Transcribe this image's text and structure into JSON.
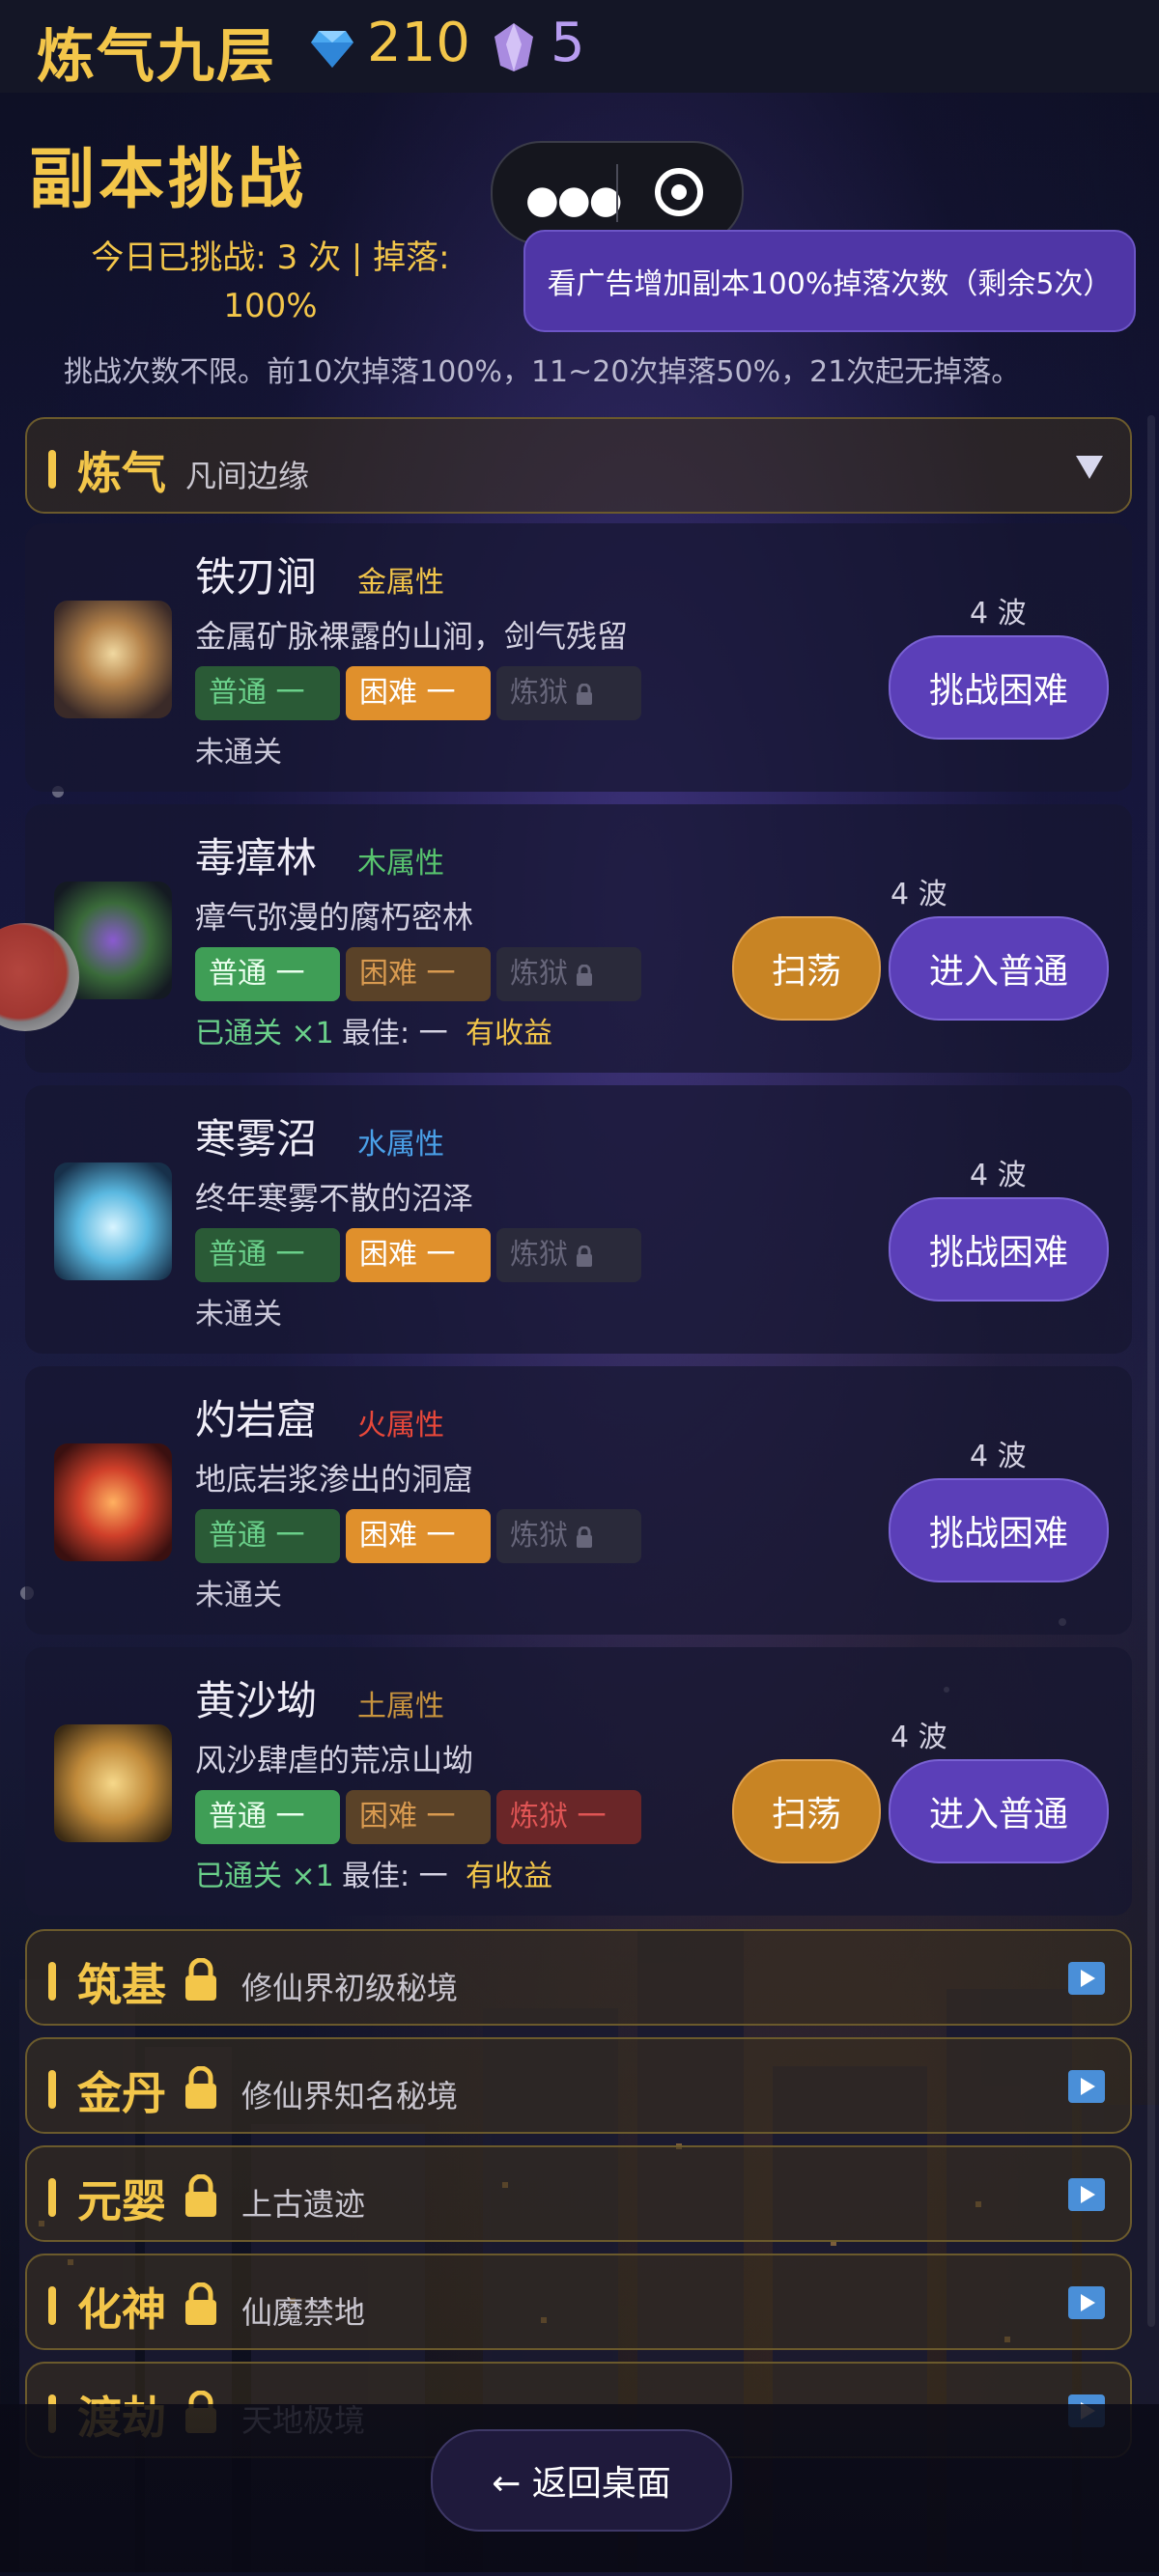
{
  "header": {
    "realm": "炼气九层",
    "gems": "210",
    "crystals": "5"
  },
  "page": {
    "title": "副本挑战",
    "today_stats": "今日已挑战: 3 次 | 掉落: 100%",
    "ad_button": "看广告增加副本100%掉落次数（剩余5次）",
    "rule": "挑战次数不限。前10次掉落100%，11~20次掉落50%，21次起无掉落。",
    "back_button": "← 返回桌面"
  },
  "expanded_category": {
    "name": "炼气",
    "subtitle": "凡间边缘"
  },
  "dungeons": [
    {
      "name": "铁刃涧",
      "element": "金属性",
      "element_color": "#f3c64a",
      "desc": "金属矿脉裸露的山涧，剑气残留",
      "normal": "普通 一",
      "hard": "困难 一",
      "hell": "炼狱",
      "waves": "4 波",
      "status": "未通关",
      "button": "挑战困难"
    },
    {
      "name": "毒瘴林",
      "element": "木属性",
      "element_color": "#58c46e",
      "desc": "瘴气弥漫的腐朽密林",
      "normal": "普通 一",
      "hard": "困难 一",
      "hell": "炼狱",
      "waves": "4 波",
      "status": "已通关 ×1",
      "best": "最佳: 一",
      "profit": "有收益",
      "sweep": "扫荡",
      "button": "进入普通"
    },
    {
      "name": "寒雾沼",
      "element": "水属性",
      "element_color": "#4aa0e8",
      "desc": "终年寒雾不散的沼泽",
      "normal": "普通 一",
      "hard": "困难 一",
      "hell": "炼狱",
      "waves": "4 波",
      "status": "未通关",
      "button": "挑战困难"
    },
    {
      "name": "灼岩窟",
      "element": "火属性",
      "element_color": "#e8483a",
      "desc": "地底岩浆渗出的洞窟",
      "normal": "普通 一",
      "hard": "困难 一",
      "hell": "炼狱",
      "waves": "4 波",
      "status": "未通关",
      "button": "挑战困难"
    },
    {
      "name": "黄沙坳",
      "element": "土属性",
      "element_color": "#c8943e",
      "desc": "风沙肆虐的荒凉山坳",
      "normal": "普通 一",
      "hard": "困难 一",
      "hell": "炼狱 一",
      "waves": "4 波",
      "status": "已通关 ×1",
      "best": "最佳: 一",
      "profit": "有收益",
      "sweep": "扫荡",
      "button": "进入普通"
    }
  ],
  "locked_categories": [
    {
      "name": "筑基",
      "subtitle": "修仙界初级秘境"
    },
    {
      "name": "金丹",
      "subtitle": "修仙界知名秘境"
    },
    {
      "name": "元婴",
      "subtitle": "上古遗迹"
    },
    {
      "name": "化神",
      "subtitle": "仙魔禁地"
    },
    {
      "name": "渡劫",
      "subtitle": "天地极境"
    }
  ],
  "colors": {
    "gold": "#f3c64a",
    "purple_button": "#5b3fb8",
    "sweep_button": "#c88424"
  },
  "icons": [
    "diamond-icon",
    "crystal-icon",
    "more-dots-icon",
    "target-icon",
    "chevron-down-icon",
    "lock-icon",
    "play-arrow-icon"
  ]
}
